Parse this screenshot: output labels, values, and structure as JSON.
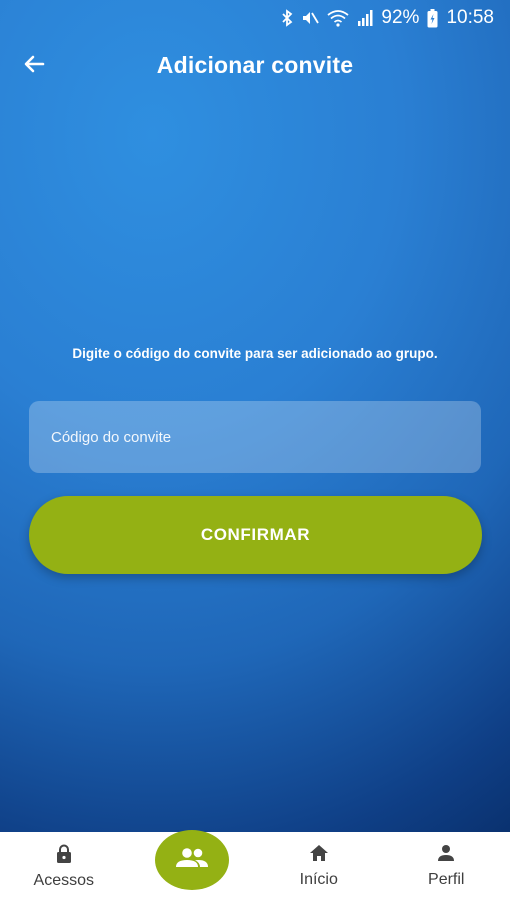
{
  "status_bar": {
    "battery": "92%",
    "time": "10:58",
    "icons": [
      "bluetooth-icon",
      "mute-icon",
      "wifi-icon",
      "signal-icon",
      "battery-icon"
    ]
  },
  "header": {
    "title": "Adicionar convite",
    "back_icon": "arrow-left-icon"
  },
  "main": {
    "instruction": "Digite o código do convite para ser adicionado ao grupo.",
    "code_input": {
      "placeholder": "Código do convite",
      "value": ""
    },
    "confirm_label": "CONFIRMAR"
  },
  "bottom_nav": {
    "items": [
      {
        "label": "Acessos",
        "icon": "lock-icon"
      },
      {
        "label": "",
        "icon": "group-icon",
        "active": true
      },
      {
        "label": "Início",
        "icon": "home-icon"
      },
      {
        "label": "Perfil",
        "icon": "person-icon"
      }
    ]
  },
  "colors": {
    "accent_green": "#94b114",
    "background_blue": "#2a7fd3",
    "nav_background": "#ffffff"
  }
}
